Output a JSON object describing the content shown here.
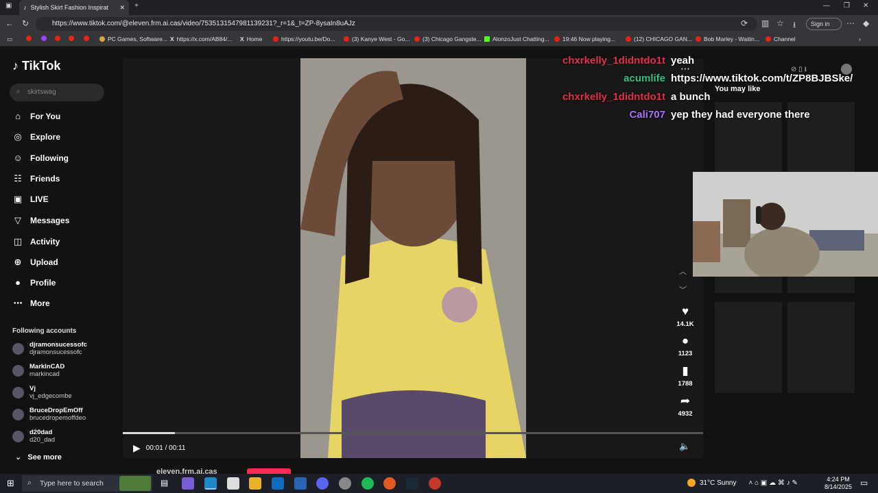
{
  "browser": {
    "tab_title": "Stylish Skirt Fashion Inspirat",
    "url": "https://www.tiktok.com/@eleven.frm.ai.cas/video/7535131547981139231?_r=1&_t=ZP-8ysaIn8uAJz",
    "signin_label": "Sign in",
    "bookmarks": [
      "PC Games, Software...",
      "https://x.com/AB84/...",
      "Home",
      "https://youtu.be/Do...",
      "(3) Kanye West - Go...",
      "(3) Chicago Gangste...",
      "AlonzoJust Chatting...",
      "19:46 Now playing...",
      "(12) CHICAGO GAN...",
      "Bob Marley - Waitin...",
      "Channel"
    ]
  },
  "tiktok": {
    "logo": "TikTok",
    "search_placeholder": "skirtswag",
    "nav": [
      "For You",
      "Explore",
      "Following",
      "Friends",
      "LIVE",
      "Messages",
      "Activity",
      "Upload",
      "Profile",
      "More"
    ],
    "nav_icons": [
      "home-icon",
      "compass-icon",
      "following-icon",
      "friends-icon",
      "live-icon",
      "messages-icon",
      "activity-icon",
      "upload-icon",
      "profile-icon",
      "more-icon"
    ],
    "following_title": "Following accounts",
    "accounts": [
      {
        "name": "djramonsucessofc",
        "handle": "djramonsucessofc"
      },
      {
        "name": "MarkInCAD",
        "handle": "markincad"
      },
      {
        "name": "Vj",
        "handle": "vj_edgecombe"
      },
      {
        "name": "BruceDropEmOff",
        "handle": "brucedropemoffdeo"
      },
      {
        "name": "d20dad",
        "handle": "d20_dad"
      }
    ],
    "see_more": "See more",
    "time": "00:01 / 00:11",
    "progress": 0.09,
    "actions": {
      "likes": "14.1K",
      "comments": "1123",
      "saves": "1788",
      "shares": "4932"
    },
    "you_may_like": "You may like",
    "author_partial": "eleven.frm.ai.cas"
  },
  "chat": [
    {
      "user": "chxrkelly_1didntdo1t",
      "msg": "yeah",
      "color": "#e0304a"
    },
    {
      "user": "acumlife",
      "msg": "https://www.tiktok.com/t/ZP8BJBSke/",
      "color": "#2ec27e"
    },
    {
      "user": "chxrkelly_1didntdo1t",
      "msg": "a bunch",
      "color": "#e0304a"
    },
    {
      "user": "Cali707",
      "msg": "yep they had everyone there",
      "color": "#a970ff"
    }
  ],
  "taskbar": {
    "search": "Type here to search",
    "weather": "31°C  Sunny",
    "time": "4:24 PM",
    "date": "8/14/2025"
  }
}
